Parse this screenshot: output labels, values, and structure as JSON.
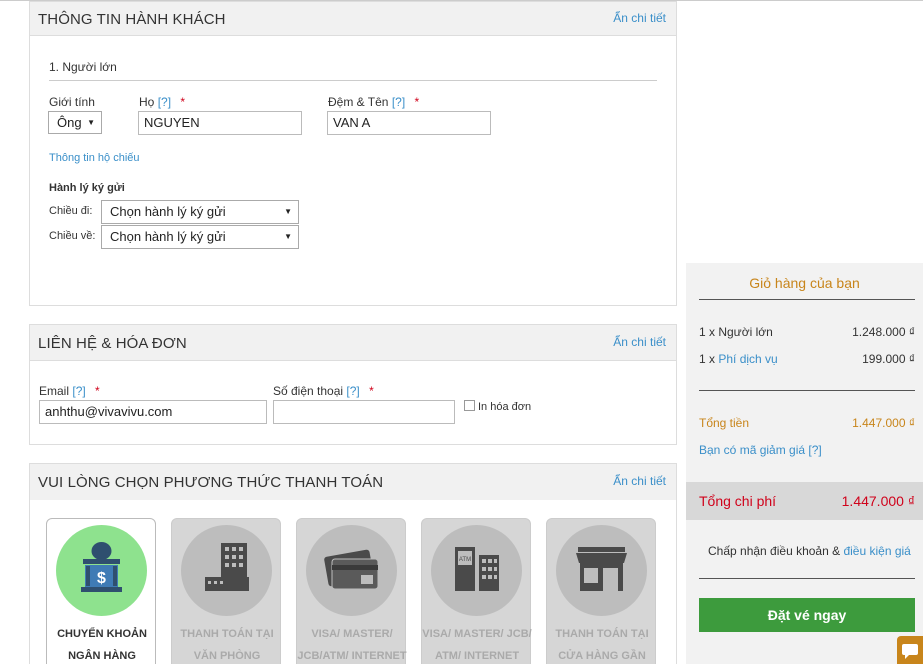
{
  "passenger": {
    "title": "THÔNG TIN HÀNH KHÁCH",
    "hide_label": "Ẩn chi tiết",
    "adult_heading": "1. Người lớn",
    "gender_label": "Giới tính",
    "gender_value": "Ông",
    "surname_label": "Họ",
    "surname_value": "NGUYEN",
    "name_label": "Đệm & Tên",
    "name_value": "VAN A",
    "help_mark": "[?]",
    "required_mark": "*",
    "passport_link": "Thông tin hộ chiếu",
    "baggage_heading": "Hành lý ký gửi",
    "outbound_label": "Chiều đi:",
    "outbound_value": "Chọn hành lý ký gửi",
    "return_label": "Chiều về:",
    "return_value": "Chọn hành lý ký gửi"
  },
  "contact": {
    "title": "LIÊN HỆ & HÓA ĐƠN",
    "hide_label": "Ẩn chi tiết",
    "email_label": "Email",
    "email_value": "anhthu@vivavivu.com",
    "phone_label": "Số điện thoại",
    "phone_value": "",
    "invoice_label": "In hóa đơn"
  },
  "payment": {
    "title": "VUI LÒNG CHỌN PHƯƠNG THỨC THANH TOÁN",
    "hide_label": "Ẩn chi tiết",
    "methods": [
      {
        "line1": "CHUYỂN KHOẢN",
        "line2": "NGÂN HÀNG",
        "icon": "bank-icon",
        "selected": true
      },
      {
        "line1": "THANH TOÁN TẠI",
        "line2": "VĂN PHÒNG",
        "icon": "office-building-icon",
        "selected": false
      },
      {
        "line1": "VISA/ MASTER/",
        "line2": "JCB/ATM/ INTERNET",
        "icon": "credit-card-icon",
        "selected": false
      },
      {
        "line1": "VISA/ MASTER/ JCB/",
        "line2": "ATM/ INTERNET",
        "icon": "atm-icon",
        "selected": false
      },
      {
        "line1": "THANH TOÁN TẠI",
        "line2": "CỬA HÀNG GẦN",
        "icon": "store-icon",
        "selected": false
      }
    ]
  },
  "cart": {
    "title": "Giỏ hàng của bạn",
    "item1_label": "1 x Người lớn",
    "item1_price": "1.248.000 ₫",
    "item2_prefix": "1 x ",
    "item2_link": "Phí dịch vụ",
    "item2_price": "199.000 ₫",
    "subtotal_label": "Tổng tiền",
    "subtotal_value": "1.447.000 ₫",
    "promo_label": "Bạn có mã giảm giá",
    "promo_help": "[?]",
    "total_label": "Tổng chi phí",
    "total_value": "1.447.000 ₫",
    "terms_text": "Chấp nhận điều khoản & ",
    "terms_link": "điều kiện giá",
    "book_button": "Đặt vé ngay"
  },
  "colors": {
    "accent_blue": "#3a8fc9",
    "cart_orange": "#c8851b",
    "total_red": "#d0021b",
    "book_green": "#3d9b3d",
    "selected_green": "#8ee28e"
  }
}
